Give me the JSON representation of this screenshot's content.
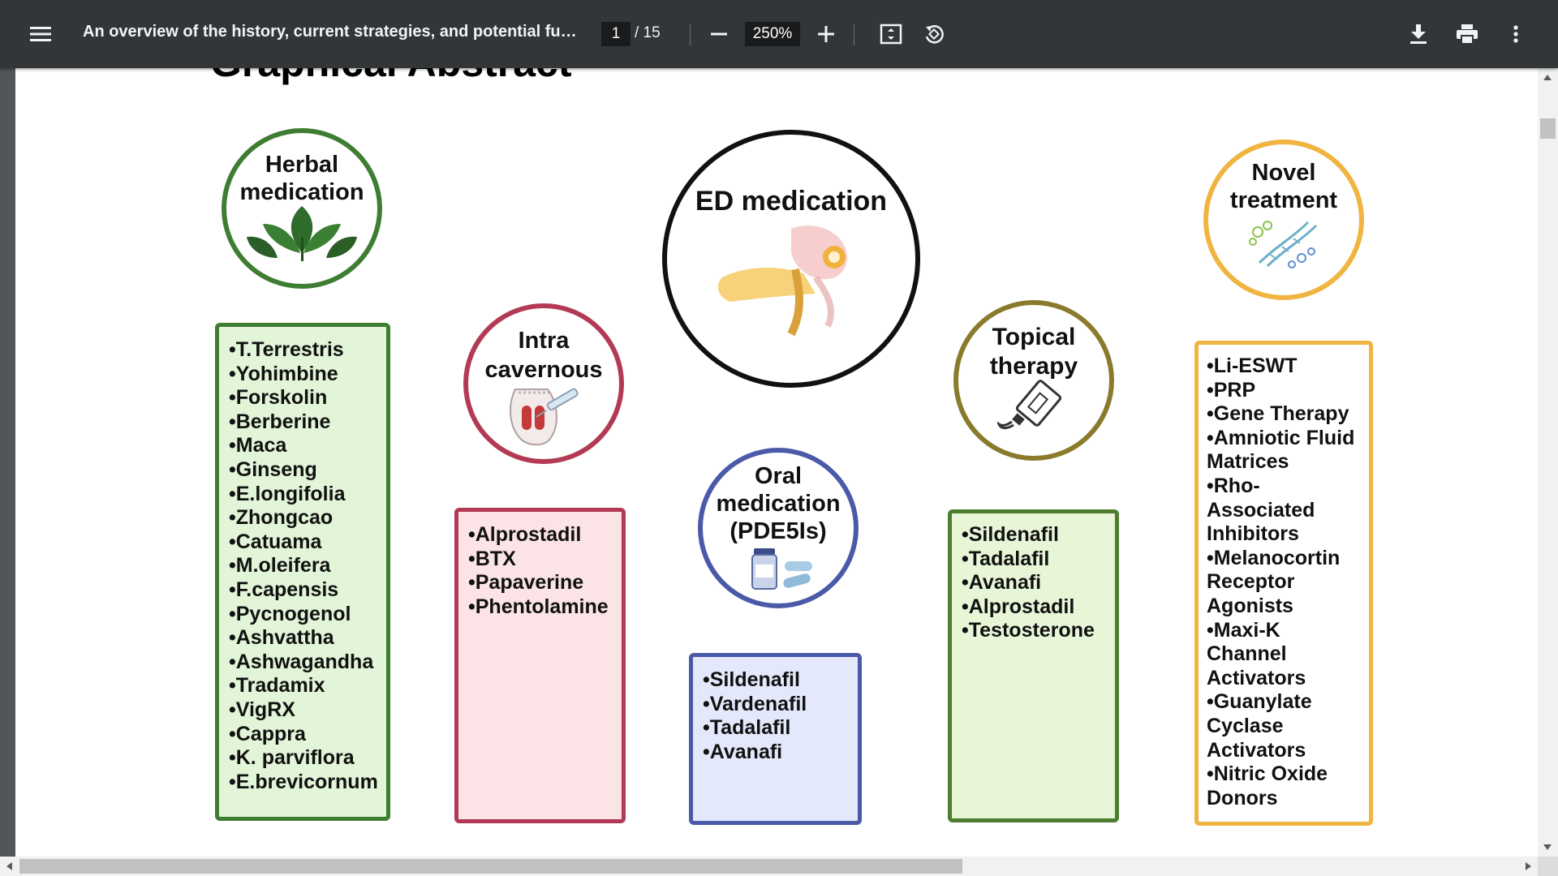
{
  "toolbar": {
    "menu_icon": "hamburger-menu-icon",
    "title": "An overview of the history, current strategies, and potential future treatments for erectile dysfunction",
    "page_current": "1",
    "page_total": "/ 15",
    "zoom": "250%",
    "icons": [
      "zoom-out-icon",
      "zoom-in-icon",
      "fit-page-icon",
      "rotate-icon",
      "download-icon",
      "print-icon",
      "more-options-icon"
    ]
  },
  "page": {
    "heading": "Graphical Abstract",
    "center": {
      "title": "ED medication",
      "icon": "anatomy-illustration-icon",
      "color": "#111111"
    },
    "herbal": {
      "title": "Herbal medication",
      "icon": "leaf-icon",
      "color": "#3f7d33",
      "fill": "#e2f5d8",
      "items": [
        "•T.Terrestris",
        "•Yohimbine",
        "•Forskolin",
        "•Berberine",
        "•Maca",
        "•Ginseng",
        "•E.longifolia",
        "•Zhongcao",
        "•Catuama",
        "•M.oleifera",
        "•F.capensis",
        "•Pycnogenol",
        "•Ashvattha",
        "•Ashwagandha",
        "•Tradamix",
        "•VigRX",
        "•Cappra",
        "•K. parviflora",
        "•E.brevicornum"
      ]
    },
    "intra": {
      "title": "Intra cavernous",
      "icon": "injection-icon",
      "color": "#b23a55",
      "fill": "#fbe3e6",
      "items": [
        "•Alprostadil",
        "•BTX",
        "•Papaverine",
        "•Phentolamine"
      ]
    },
    "oral": {
      "title": "Oral medication (PDE5Is)",
      "icon": "pill-bottle-icon",
      "color": "#4a5aa8",
      "fill": "#e4e8fb",
      "items": [
        "•Sildenafil",
        "•Vardenafil",
        "•Tadalafil",
        "•Avanafi"
      ]
    },
    "topical": {
      "title": "Topical therapy",
      "icon": "ointment-tube-icon",
      "color": "#8a7a2c",
      "box_color": "#4e7d2f",
      "fill": "#e8f6d8",
      "items": [
        "•Sildenafil",
        "•Tadalafil",
        "•Avanafi",
        "•Alprostadil",
        "•Testosterone"
      ]
    },
    "novel": {
      "title": "Novel treatment",
      "icon": "dna-molecule-icon",
      "color": "#f0b440",
      "fill": "#ffffff",
      "items": [
        "•Li-ESWT",
        "•PRP",
        "•Gene Therapy",
        "•Amniotic Fluid Matrices",
        "•Rho-Associated Inhibitors",
        "•Melanocortin Receptor Agonists",
        "•Maxi-K Channel Activators",
        "•Guanylate Cyclase Activators",
        "•Nitric Oxide Donors"
      ]
    }
  }
}
